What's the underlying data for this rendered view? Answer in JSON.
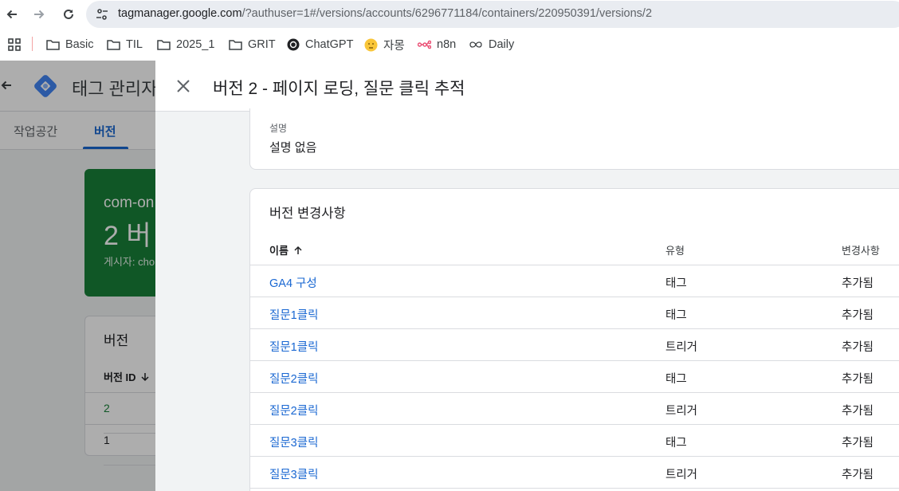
{
  "browser": {
    "url_host": "tagmanager.google.com",
    "url_path": "/?authuser=1#/versions/accounts/6296771184/containers/220950391/versions/2",
    "bookmarks": [
      {
        "label": "Basic",
        "icon": "folder-icon"
      },
      {
        "label": "TIL",
        "icon": "folder-icon"
      },
      {
        "label": "2025_1",
        "icon": "folder-icon"
      },
      {
        "label": "GRIT",
        "icon": "folder-icon"
      },
      {
        "label": "ChatGPT",
        "icon": "chatgpt-icon"
      },
      {
        "label": "자몽",
        "icon": "emoji-icon"
      },
      {
        "label": "n8n",
        "icon": "n8n-icon"
      },
      {
        "label": "Daily",
        "icon": "infinity-icon"
      }
    ]
  },
  "app": {
    "title": "태그 관리자",
    "tabs": [
      "작업공간",
      "버전"
    ],
    "active_tab": "버전",
    "summary_card": {
      "line1": "com-on",
      "line2": "2 버",
      "line3": "게시자: cho"
    },
    "versions_card": {
      "title": "버전",
      "header": "버전 ID",
      "rows": [
        "2",
        "1"
      ]
    }
  },
  "panel": {
    "title": "버전 2 - 페이지 로딩, 질문 클릭 추적",
    "description_label": "설명",
    "description_value": "설명 없음",
    "changes_title": "버전 변경사항",
    "columns": {
      "name": "이름",
      "type": "유형",
      "change": "변경사항"
    },
    "rows": [
      {
        "name": "GA4 구성",
        "type": "태그",
        "change": "추가됨"
      },
      {
        "name": "질문1클릭",
        "type": "태그",
        "change": "추가됨"
      },
      {
        "name": "질문1클릭",
        "type": "트리거",
        "change": "추가됨"
      },
      {
        "name": "질문2클릭",
        "type": "태그",
        "change": "추가됨"
      },
      {
        "name": "질문2클릭",
        "type": "트리거",
        "change": "추가됨"
      },
      {
        "name": "질문3클릭",
        "type": "태그",
        "change": "추가됨"
      },
      {
        "name": "질문3클릭",
        "type": "트리거",
        "change": "추가됨"
      }
    ]
  },
  "colors": {
    "link": "#1967d2",
    "green": "#188038",
    "accent": "#1967d2"
  }
}
